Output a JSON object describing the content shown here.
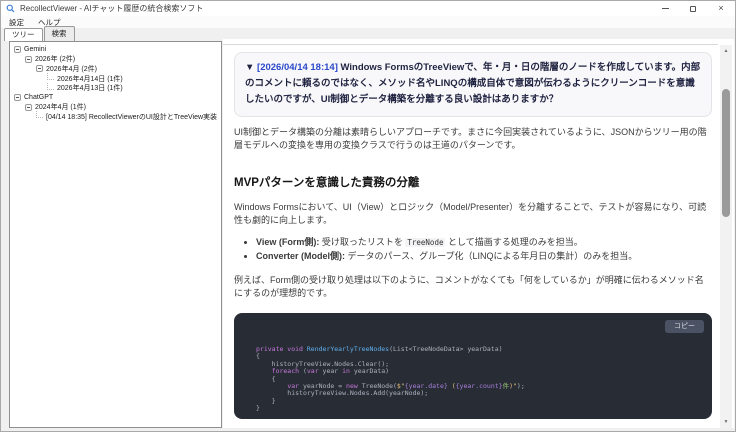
{
  "window": {
    "title": "RecollectViewer - AIチャット履歴の統合検索ソフト",
    "controls": {
      "close_glyph": "×"
    }
  },
  "menu": {
    "items": [
      "設定",
      "ヘルプ"
    ]
  },
  "tabs": [
    {
      "label": "ツリー",
      "active": true
    },
    {
      "label": "検索",
      "active": false
    }
  ],
  "tree": {
    "items": [
      {
        "depth": 0,
        "label": "Gemini",
        "expandable": true
      },
      {
        "depth": 1,
        "label": "2026年 (2件)",
        "expandable": true
      },
      {
        "depth": 2,
        "label": "2026年4月 (2件)",
        "expandable": true
      },
      {
        "depth": 3,
        "label": "2026年4月14日 (1件)",
        "expandable": false
      },
      {
        "depth": 3,
        "label": "2026年4月13日 (1件)",
        "expandable": false
      },
      {
        "depth": 0,
        "label": "ChatGPT",
        "expandable": true
      },
      {
        "depth": 1,
        "label": "2024年4月 (1件)",
        "expandable": true
      },
      {
        "depth": 2,
        "label": "[04/14 18:35] RecollectViewerのUI設計とTreeView実装",
        "expandable": false
      }
    ]
  },
  "content": {
    "question": {
      "collapse_marker": "▼ ",
      "timestamp": "[2026/04/14 18:14]",
      "text": " Windows FormsのTreeViewで、年・月・日の階層のノードを作成しています。内部のコメントに頼るのではなく、メソッド名やLINQの構成自体で意図が伝わるようにクリーンコードを意識したいのですが、UI制御とデータ構築を分離する良い設計はありますか？"
    },
    "paragraph1": "UI制御とデータ構築の分離は素晴らしいアプローチです。まさに今回実装されているように、JSONからツリー用の階層モデルへの変換を専用の変換クラスで行うのは王道のパターンです。",
    "heading": "MVPパターンを意識した責務の分離",
    "paragraph2": "Windows Formsにおいて、UI（View）とロジック（Model/Presenter）を分離することで、テストが容易になり、可読性も劇的に向上します。",
    "bullets": [
      {
        "segments": [
          {
            "t": "View (Form側):",
            "b": true
          },
          {
            "t": " 受け取ったリストを "
          },
          {
            "t": "TreeNode",
            "mono": true
          },
          {
            "t": " として描画する処理のみを担当。"
          }
        ]
      },
      {
        "segments": [
          {
            "t": "Converter (Model側):",
            "b": true
          },
          {
            "t": " データのパース、グループ化（LINQによる年月日の集計）のみを担当。"
          }
        ]
      }
    ],
    "paragraph3": "例えば、Form側の受け取り処理は以下のように、コメントがなくても「何をしているか」が明確に伝わるメソッド名にするのが理想的です。",
    "code_block": {
      "copy_label": "コピー",
      "colors": {
        "kw": "#c678dd",
        "fn": "#61afef",
        "str": "#e5c07b",
        "plain": "#abb2bf",
        "green": "#98c379",
        "interp": "#a87fdd"
      },
      "lines": [
        [
          {
            "t": "private void ",
            "c": "kw"
          },
          {
            "t": "RenderYearlyTreeNodes",
            "c": "fn"
          },
          {
            "t": "(List<TreeNodeData> yearData)",
            "c": "plain"
          }
        ],
        [
          {
            "t": "{",
            "c": "plain"
          }
        ],
        [
          {
            "t": "    historyTreeView.Nodes.Clear();",
            "c": "plain"
          }
        ],
        [
          {
            "t": "    ",
            "c": "plain"
          },
          {
            "t": "foreach",
            "c": "kw"
          },
          {
            "t": " (",
            "c": "plain"
          },
          {
            "t": "var",
            "c": "kw"
          },
          {
            "t": " year ",
            "c": "plain"
          },
          {
            "t": "in",
            "c": "kw"
          },
          {
            "t": " yearData)",
            "c": "plain"
          }
        ],
        [
          {
            "t": "    {",
            "c": "plain"
          }
        ],
        [
          {
            "t": "        ",
            "c": "plain"
          },
          {
            "t": "var",
            "c": "kw"
          },
          {
            "t": " yearNode = ",
            "c": "plain"
          },
          {
            "t": "new",
            "c": "kw"
          },
          {
            "t": " TreeNode(",
            "c": "plain"
          },
          {
            "t": "$\"",
            "c": "str"
          },
          {
            "t": "{year.date}",
            "c": "interp"
          },
          {
            "t": " (",
            "c": "str"
          },
          {
            "t": "{year.count}",
            "c": "interp"
          },
          {
            "t": "件",
            "c": "green"
          },
          {
            "t": ")\"",
            "c": "str"
          },
          {
            "t": ");",
            "c": "plain"
          }
        ],
        [
          {
            "t": "        historyTreeView.Nodes.Add(yearNode);",
            "c": "plain"
          }
        ],
        [
          {
            "t": "    }",
            "c": "plain"
          }
        ],
        [
          {
            "t": "}",
            "c": "plain"
          }
        ]
      ]
    }
  },
  "scrollbar": {
    "up_glyph": "▲",
    "down_glyph": "▼"
  }
}
